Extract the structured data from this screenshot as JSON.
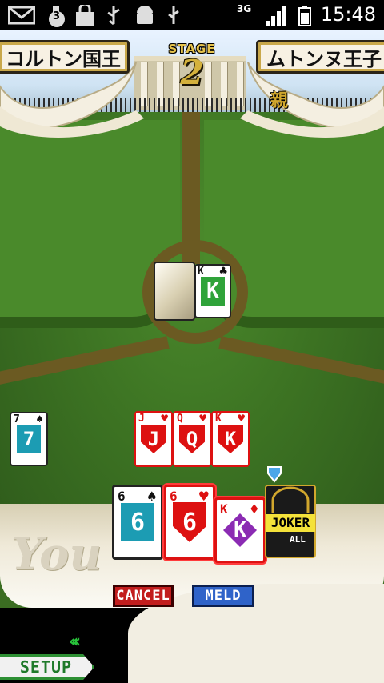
{
  "status_bar": {
    "time": "15:48",
    "network": "3G",
    "notification_count": "3"
  },
  "header": {
    "left_player": "コルトン国王",
    "right_player": "ムトンヌ王子",
    "stage_label": "STAGE",
    "stage_number": "2",
    "dealer_marker": "親"
  },
  "table": {
    "played_card": {
      "rank": "K",
      "suit": "clubs",
      "color": "#2fa33a"
    }
  },
  "left_player_card": {
    "rank": "7",
    "suit": "spades",
    "color": "#1c9cb3"
  },
  "melded_cards": [
    {
      "rank": "J",
      "suit": "hearts",
      "color": "#d11"
    },
    {
      "rank": "Q",
      "suit": "hearts",
      "color": "#d11"
    },
    {
      "rank": "K",
      "suit": "hearts",
      "color": "#d11"
    }
  ],
  "hand": {
    "player_label": "You",
    "cards": [
      {
        "rank": "6",
        "suit": "spades",
        "color": "#1c9cb3"
      },
      {
        "rank": "6",
        "suit": "hearts",
        "color": "#d11"
      },
      {
        "rank": "K",
        "suit": "diamonds",
        "color": "#8b2bb3"
      }
    ],
    "joker": {
      "label": "JOKER",
      "sub_label": "ALL"
    }
  },
  "buttons": {
    "cancel": "CANCEL",
    "meld": "MELD",
    "setup": "SETUP"
  }
}
